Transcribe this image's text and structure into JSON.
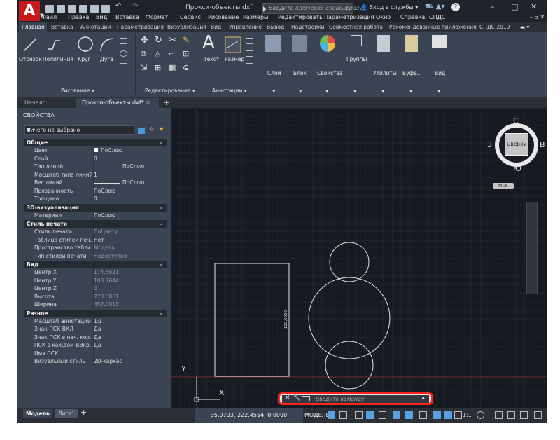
{
  "titlebar": {
    "logo": "A",
    "doc_title": "Прокси-объекты.dxf",
    "search_placeholder": "Введите ключевое слово/фразу",
    "signin": "Вход в службы",
    "help": "?",
    "minimize": "–",
    "maximize": "□",
    "close": "✕"
  },
  "menus": [
    "Файл",
    "Правка",
    "Вид",
    "Вставка",
    "Формат",
    "Сервис",
    "Рисование",
    "Размеры",
    "Редактировать",
    "Параметризация",
    "Окно",
    "Справка",
    "СПДС"
  ],
  "ribbon_tabs": [
    "Главная",
    "Вставка",
    "Аннотации",
    "Параметризация",
    "Визуализация",
    "Вид",
    "Управление",
    "Вывод",
    "Надстройки",
    "Совместная работа",
    "Рекомендованные приложения",
    "СПДС 2019"
  ],
  "ribbon": {
    "draw": [
      "Отрезок",
      "Полилиния",
      "Круг",
      "Дуга"
    ],
    "annot": [
      "Текст",
      "Размер"
    ],
    "big": [
      "Слои",
      "Блок",
      "Свойства",
      "Группы",
      "Утилиты",
      "Буфе...",
      "Вид"
    ],
    "groups": [
      "Рисование",
      "Редактирование",
      "Аннотации"
    ]
  },
  "file_tabs": {
    "start": "Начало",
    "current": "Прокси-объекты.dxf*",
    "add": "+"
  },
  "properties": {
    "title": "СВОЙСТВА",
    "selection": "Ничего не выбрано",
    "sections": [
      {
        "name": "Общие",
        "rows": [
          {
            "k": "Цвет",
            "v": "ПоСлою",
            "kind": "swatch"
          },
          {
            "k": "Слой",
            "v": "0"
          },
          {
            "k": "Тип линий",
            "v": "ПоСлою",
            "kind": "line"
          },
          {
            "k": "Масштаб типа линий",
            "v": "1"
          },
          {
            "k": "Вес линий",
            "v": "ПоСлою",
            "kind": "line"
          },
          {
            "k": "Прозрачность",
            "v": "ПоСлою"
          },
          {
            "k": "Толщина",
            "v": "0"
          }
        ]
      },
      {
        "name": "3D-визуализация",
        "rows": [
          {
            "k": "Материал",
            "v": "ПоСлою"
          }
        ]
      },
      {
        "name": "Стиль печати",
        "rows": [
          {
            "k": "Стиль печати",
            "v": "ПоЦвету",
            "kind": "dim"
          },
          {
            "k": "Таблица стилей печ...",
            "v": "Нет"
          },
          {
            "k": "Пространство табли...",
            "v": "Модель",
            "kind": "dim"
          },
          {
            "k": "Тип стилей печати",
            "v": "Недоступно",
            "kind": "dim"
          }
        ]
      },
      {
        "name": "Вид",
        "rows": [
          {
            "k": "Центр X",
            "v": "174.5821",
            "kind": "dim"
          },
          {
            "k": "Центр Y",
            "v": "103.7644",
            "kind": "dim"
          },
          {
            "k": "Центр Z",
            "v": "0",
            "kind": "dim"
          },
          {
            "k": "Высота",
            "v": "273.0861",
            "kind": "dim"
          },
          {
            "k": "Ширина",
            "v": "457.0013",
            "kind": "dim"
          }
        ]
      },
      {
        "name": "Разное",
        "rows": [
          {
            "k": "Масштаб аннотаций",
            "v": "1:1"
          },
          {
            "k": "Знак ПСК ВКЛ",
            "v": "Да"
          },
          {
            "k": "Знак ПСК в нач. коо...",
            "v": "Да"
          },
          {
            "k": "ПСК в каждом ВЭкр...",
            "v": "Да"
          },
          {
            "k": "Имя ПСК",
            "v": ""
          },
          {
            "k": "Визуальный стиль",
            "v": "2D-каркас"
          }
        ]
      }
    ]
  },
  "viewcube": {
    "north": "С",
    "south": "Ю",
    "west": "З",
    "east": "В",
    "top": "Сверху",
    "wcs": "МСК"
  },
  "canvas": {
    "dimension_text": "100,0000",
    "ucs_x": "X",
    "ucs_y": "Y"
  },
  "command": {
    "placeholder": "Введите команду"
  },
  "status": {
    "model_tab": "Модель",
    "layout_tab": "Лист1",
    "add_layout": "+",
    "coords": "35.9703, 222.4554, 0.0000",
    "mode": "МОДЕЛЬ",
    "scale": "1:1"
  },
  "colors": {
    "autocad_red": "#c8191d",
    "highlight": "#ff2020",
    "canvas_bg": "#171a21",
    "ui_bg": "#3b4453"
  }
}
